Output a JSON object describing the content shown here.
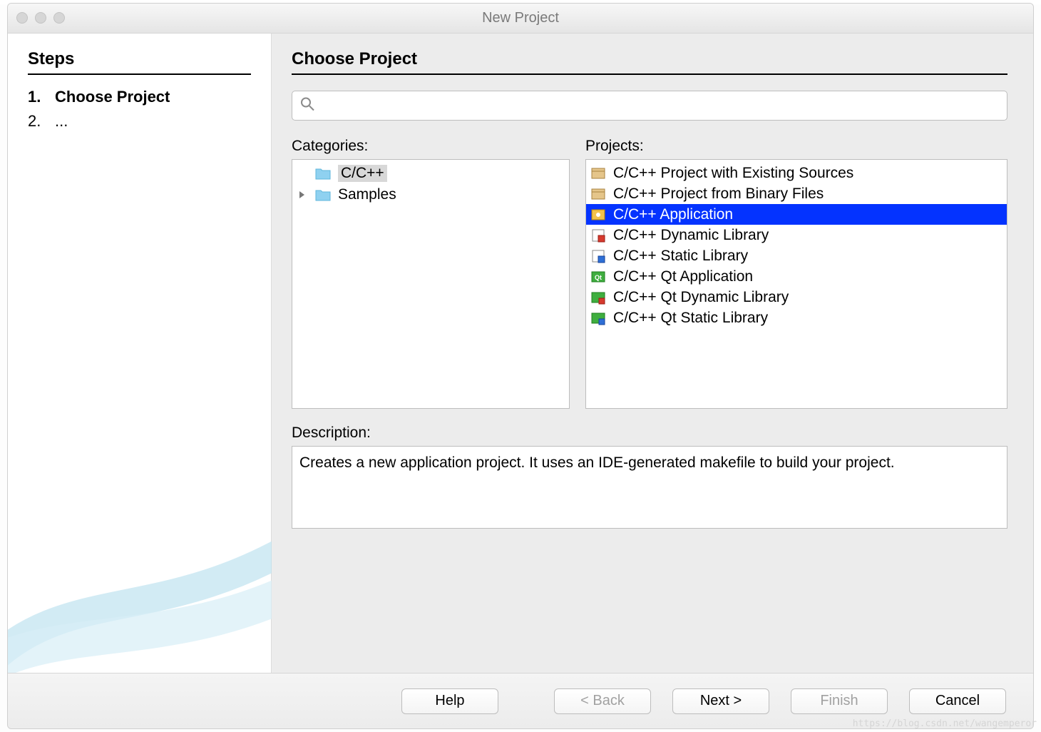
{
  "window": {
    "title": "New Project"
  },
  "sidebar": {
    "heading": "Steps",
    "steps": [
      {
        "num": "1.",
        "label": "Choose Project",
        "current": true
      },
      {
        "num": "2.",
        "label": "...",
        "current": false
      }
    ]
  },
  "main": {
    "heading": "Choose Project",
    "search": {
      "value": "",
      "placeholder": ""
    },
    "categories_label": "Categories:",
    "projects_label": "Projects:",
    "description_label": "Description:",
    "categories": [
      {
        "label": "C/C++",
        "expandable": false,
        "selected": true
      },
      {
        "label": "Samples",
        "expandable": true,
        "selected": false
      }
    ],
    "selected_category_index": 0,
    "projects": [
      {
        "label": "C/C++ Project with Existing Sources",
        "icon": "box-icon",
        "selected": false
      },
      {
        "label": "C/C++ Project from Binary Files",
        "icon": "box-icon",
        "selected": false
      },
      {
        "label": "C/C++ Application",
        "icon": "app-icon",
        "selected": true
      },
      {
        "label": "C/C++ Dynamic Library",
        "icon": "dynlib-icon",
        "selected": false
      },
      {
        "label": "C/C++ Static Library",
        "icon": "statlib-icon",
        "selected": false
      },
      {
        "label": "C/C++ Qt Application",
        "icon": "qt-app-icon",
        "selected": false
      },
      {
        "label": "C/C++ Qt Dynamic Library",
        "icon": "qt-dynlib-icon",
        "selected": false
      },
      {
        "label": "C/C++ Qt Static Library",
        "icon": "qt-statlib-icon",
        "selected": false
      }
    ],
    "selected_project_index": 2,
    "description": "Creates a new application project. It uses an IDE-generated makefile to build your project."
  },
  "footer": {
    "help": "Help",
    "back": "< Back",
    "next": "Next >",
    "finish": "Finish",
    "cancel": "Cancel",
    "back_enabled": false,
    "next_enabled": true,
    "finish_enabled": false
  },
  "watermark": "https://blog.csdn.net/wangemperor",
  "icons": {
    "folder_fill": "#8fd1f0",
    "folder_stroke": "#5fb6db"
  }
}
